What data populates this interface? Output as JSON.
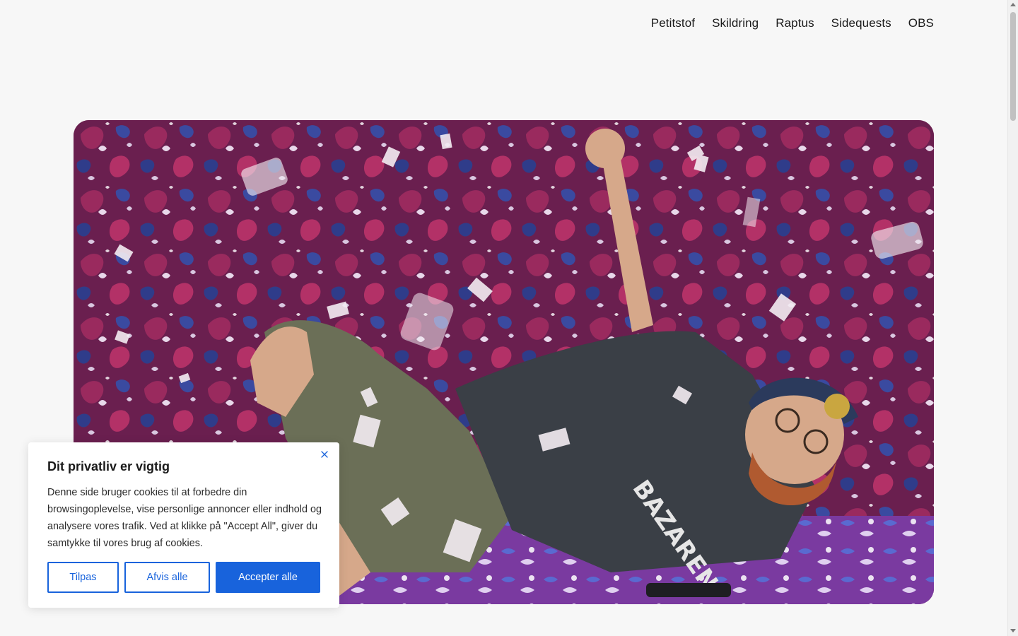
{
  "nav": {
    "items": [
      {
        "label": "Petitstof"
      },
      {
        "label": "Skildring"
      },
      {
        "label": "Raptus"
      },
      {
        "label": "Sidequests"
      },
      {
        "label": "OBS"
      }
    ]
  },
  "hero": {
    "shirt_text": "BAZAREN"
  },
  "cookie": {
    "title": "Dit privatliv er vigtig",
    "body": "Denne side bruger cookies til at forbedre din browsingoplevelse, vise personlige annoncer eller indhold og analysere vores trafik. Ved at klikke på \"Accept All\", giver du samtykke til vores brug af cookies.",
    "customize_label": "Tilpas",
    "reject_label": "Afvis alle",
    "accept_label": "Accepter alle",
    "close_icon": "close-icon"
  },
  "colors": {
    "accent": "#1863dc",
    "background": "#f7f7f7"
  }
}
